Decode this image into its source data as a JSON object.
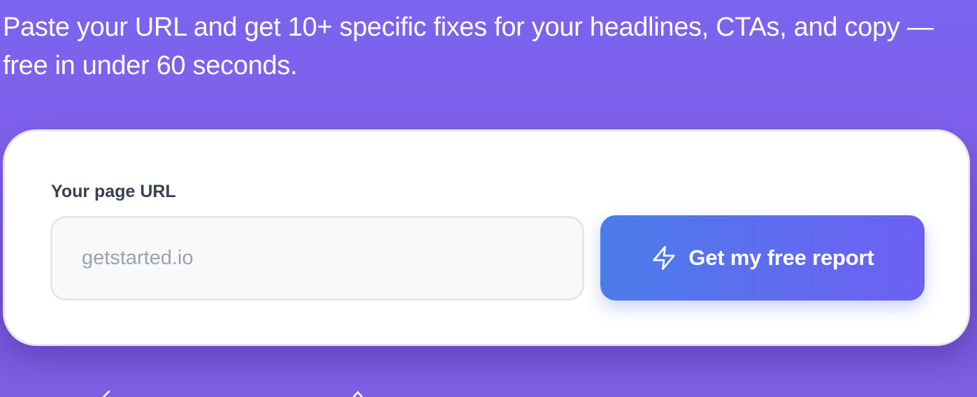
{
  "hero": {
    "subtitle": "Paste your URL and get 10+ specific fixes for your headlines, CTAs, and copy — free in under 60 seconds."
  },
  "form": {
    "url_label": "Your page URL",
    "url_placeholder": "getstarted.io",
    "url_value": "",
    "submit_label": "Get my free report",
    "submit_icon": "lightning-bolt-icon"
  },
  "colors": {
    "background_top": "#7b64ee",
    "background_bottom": "#7656d6",
    "card_background": "#ffffff",
    "button_gradient_start": "#4a7de8",
    "button_gradient_end": "#6d60f3",
    "label_text": "#374151",
    "placeholder_text": "#9ca3af"
  }
}
